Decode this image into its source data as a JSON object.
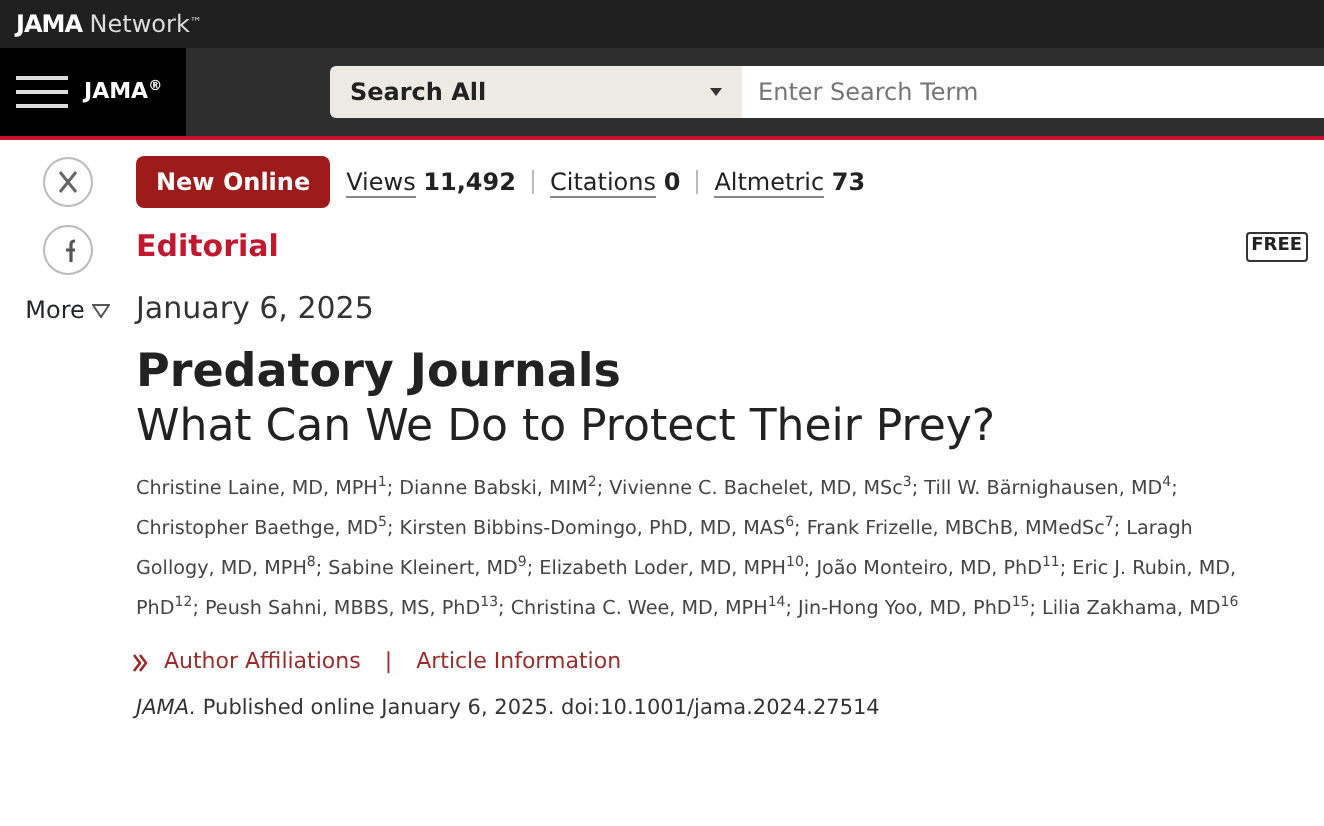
{
  "network_bar": {
    "brand": "JAMA Network",
    "trademark": "™"
  },
  "header": {
    "journal": "JAMA",
    "registered": "®",
    "search_scope": "Search All",
    "search": {
      "placeholder": "Enter Search Term"
    }
  },
  "share": {
    "more": "More"
  },
  "metrics": {
    "badge": "New Online",
    "items": [
      {
        "label": "Views",
        "value": "11,492"
      },
      {
        "label": "Citations",
        "value": "0"
      },
      {
        "label": "Altmetric",
        "value": "73"
      }
    ]
  },
  "article": {
    "type": "Editorial",
    "access": "FREE",
    "date": "January 6, 2025",
    "title": "Predatory Journals",
    "subtitle": "What Can We Do to Protect Their Prey?",
    "authors": "Christine Laine, MD, MPH$^{1}$; Dianne Babski, MIM$^{2}$; Vivienne C. Bachelet, MD, MSc$^{3}$; Till W. Bärnighausen, MD$^{4}$; Christopher Baethge, MD$^{5}$; Kirsten Bibbins-Domingo, PhD, MD, MAS$^{6}$; Frank Frizelle, MBChB, MMedSc$^{7}$; Laragh Gollogy, MD, MPH$^{8}$; Sabine Kleinert, MD$^{9}$; Elizabeth Loder, MD, MPH$^{10}$; João Monteiro, MD, PhD$^{11}$; Eric J. Rubin, MD, PhD$^{12}$; Peush Sahni, MBBS, MS, PhD$^{13}$; Christina C. Wee, MD, MPH$^{14}$; Jin-Hong Yoo, MD, PhD$^{15}$; Lilia Zakhama, MD$^{16}$",
    "links": [
      "Author Affiliations",
      "Article Information"
    ],
    "link_separator": "|",
    "citation": "*JAMA.* Published online January 6, 2025. doi:10.1001/jama.2024.27514"
  }
}
